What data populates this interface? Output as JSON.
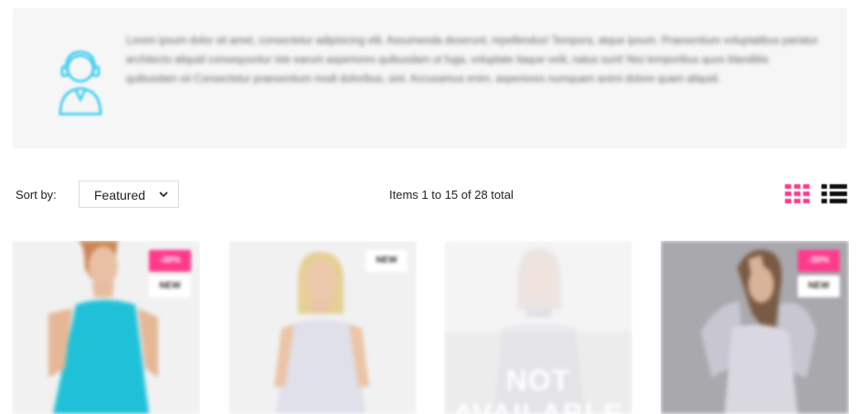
{
  "info": {
    "text": "Lorem ipsum dolor sit amet, consectetur adipisicing elit. Assumenda deserunt, repellendus! Tempora, atque ipsum. Praesentium voluptatibus pariatur architecto aliquid consequuntur iste earum asperiores quibusdam ut fuga, voluptate itaque velit, natus sunt! Nisi temporibus quos blanditiis quibusdam eii Consectetur praesentium modi doloribus, sint. Accusamus enim, asperiores numquam animi dolore quam aliquid.",
    "icon": "support-agent-icon",
    "icon_color": "#4fd1f5"
  },
  "toolbar": {
    "sort_label": "Sort by:",
    "sort_value": "Featured",
    "items_count": "Items 1 to 15 of 28 total",
    "grid_view_icon": "grid-view-icon",
    "list_view_icon": "list-view-icon",
    "active_view_color": "#ff3a8c"
  },
  "products": [
    {
      "badges": [
        {
          "type": "sale",
          "text": "-30%"
        },
        {
          "type": "new",
          "text": "NEW"
        }
      ]
    },
    {
      "badges": [
        {
          "type": "new",
          "text": "NEW"
        }
      ]
    },
    {
      "badges": [],
      "overlay_text": "NOT AVAILABLE"
    },
    {
      "badges": [
        {
          "type": "sale",
          "text": "-30%"
        },
        {
          "type": "new",
          "text": "NEW"
        }
      ]
    }
  ],
  "colors": {
    "accent": "#ff3a8c",
    "panel": "#f6f6f6"
  }
}
